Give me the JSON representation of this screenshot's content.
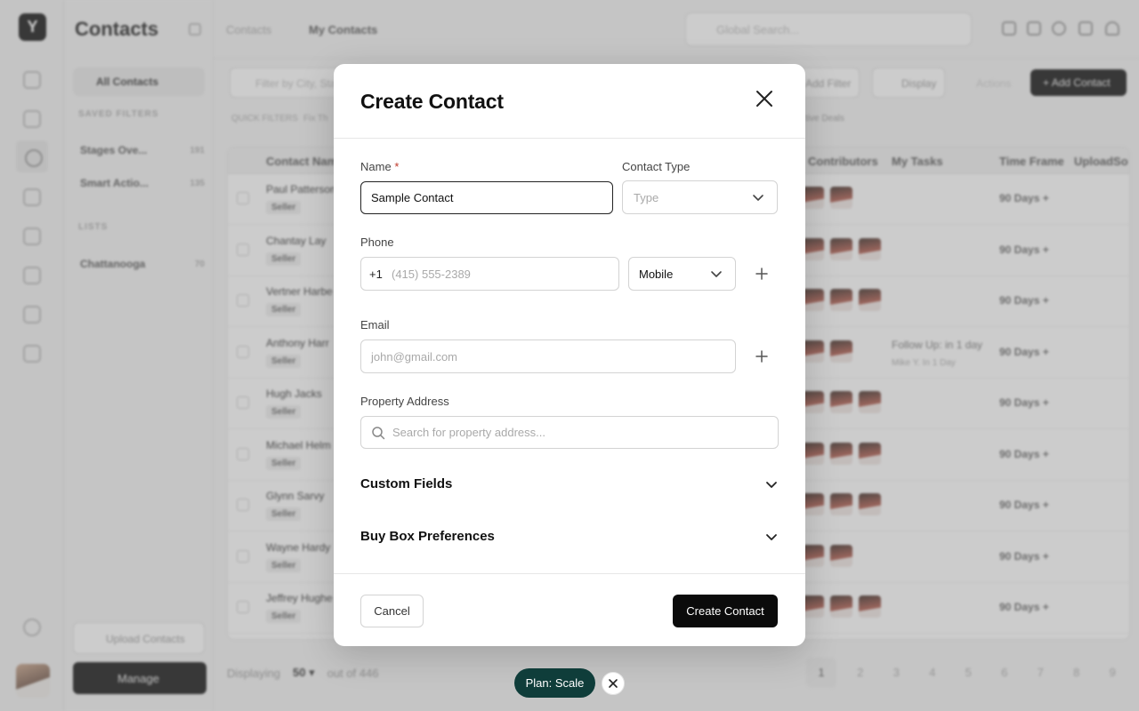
{
  "app": {
    "logo_glyph": "Y",
    "sidebar": {
      "title": "Contacts",
      "all_contacts": "All Contacts",
      "saved_filters_heading": "SAVED FILTERS",
      "filters": [
        {
          "label": "Stages Ove...",
          "count": "191"
        },
        {
          "label": "Smart Actio...",
          "count": "135"
        }
      ],
      "lists_heading": "LISTS",
      "lists": [
        {
          "label": "Chattanooga",
          "count": "70"
        }
      ],
      "upload_label": "Upload Contacts",
      "manage_label": "Manage"
    },
    "topbar": {
      "breadcrumb": [
        "Contacts",
        "My Contacts"
      ],
      "search_placeholder": "Global Search..."
    },
    "toolbar": {
      "filter_placeholder": "Filter by City, Sta",
      "add_filter": "Add Filter",
      "display": "Display",
      "actions": "Actions",
      "add_contact": "Add Contact",
      "quick_filters": "QUICK FILTERS",
      "quick_filter_item": "Fix Th",
      "active_deals": "tive Deals"
    },
    "table": {
      "headers": [
        "Contact Name",
        "Contributors",
        "My Tasks",
        "Time Frame",
        "UploadSo"
      ],
      "rows": [
        {
          "name": "Paul Patterson",
          "tag": "Seller",
          "timeframe": "90 Days +",
          "task": "",
          "task_sub": ""
        },
        {
          "name": "Chantay Lay",
          "tag": "Seller",
          "timeframe": "90 Days +",
          "task": "",
          "task_sub": ""
        },
        {
          "name": "Vertner Harbe",
          "tag": "Seller",
          "timeframe": "90 Days +",
          "task": "",
          "task_sub": ""
        },
        {
          "name": "Anthony Harr",
          "tag": "Seller",
          "timeframe": "90 Days +",
          "task": "Follow Up: in 1 day",
          "task_sub": "Mike Y.   In 1 Day"
        },
        {
          "name": "Hugh Jacks",
          "tag": "Seller",
          "timeframe": "90 Days +",
          "task": "",
          "task_sub": ""
        },
        {
          "name": "Michael Helm",
          "tag": "Seller",
          "timeframe": "90 Days +",
          "task": "",
          "task_sub": ""
        },
        {
          "name": "Glynn Sarvy",
          "tag": "Seller",
          "timeframe": "90 Days +",
          "task": "",
          "task_sub": ""
        },
        {
          "name": "Wayne Hardy",
          "tag": "Seller",
          "timeframe": "90 Days +",
          "task": "",
          "task_sub": ""
        },
        {
          "name": "Jeffrey Hughe",
          "tag": "Seller",
          "timeframe": "90 Days +",
          "task": "",
          "task_sub": ""
        }
      ]
    },
    "pagination": {
      "displaying": "Displaying",
      "page_size": "50",
      "out_of": "out of 446",
      "pages": [
        "1",
        "2",
        "3",
        "4",
        "5",
        "6",
        "7",
        "8",
        "9"
      ]
    }
  },
  "modal": {
    "title": "Create Contact",
    "name": {
      "label": "Name",
      "required_mark": "*",
      "value": "Sample Contact"
    },
    "contact_type": {
      "label": "Contact Type",
      "placeholder": "Type"
    },
    "phone": {
      "label": "Phone",
      "country_code": "+1",
      "placeholder": "(415) 555-2389",
      "type_value": "Mobile"
    },
    "email": {
      "label": "Email",
      "placeholder": "john@gmail.com"
    },
    "address": {
      "label": "Property Address",
      "placeholder": "Search for property address..."
    },
    "sections": {
      "custom_fields": "Custom Fields",
      "buy_box": "Buy Box Preferences"
    },
    "buttons": {
      "cancel": "Cancel",
      "create": "Create Contact"
    }
  },
  "plan_pill": {
    "label": "Plan: Scale"
  },
  "colors": {
    "plan_pill": "#0f3d3a",
    "primary_button": "#0b0b0b",
    "required": "#c0392b"
  }
}
